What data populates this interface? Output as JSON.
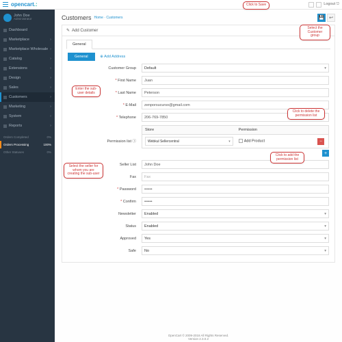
{
  "brand": {
    "name": "opencart"
  },
  "top": {
    "logout": "Logout"
  },
  "user": {
    "name": "John Doe",
    "role": "Administrator"
  },
  "nav": {
    "items": [
      {
        "label": "Dashboard"
      },
      {
        "label": "Marketplace"
      },
      {
        "label": "Marketplace Wholesale"
      },
      {
        "label": "Catalog"
      },
      {
        "label": "Extensions"
      },
      {
        "label": "Design"
      },
      {
        "label": "Sales"
      },
      {
        "label": "Customers"
      },
      {
        "label": "Marketing"
      },
      {
        "label": "System"
      },
      {
        "label": "Reports"
      }
    ],
    "sub": [
      {
        "label": "Orders Completed",
        "val": "0%"
      },
      {
        "label": "Orders Processing",
        "val": "100%"
      },
      {
        "label": "Other Statuses",
        "val": "0%"
      }
    ]
  },
  "page": {
    "title": "Customers",
    "crumb_home": "Home",
    "crumb_cur": "Customers",
    "panel": "Add Customer"
  },
  "tabs": {
    "general": "General"
  },
  "subtabs": {
    "general": "General",
    "add_addr": "Add Address"
  },
  "labels": {
    "group": "Customer Group",
    "fname": "First Name",
    "lname": "Last Name",
    "email": "E-Mail",
    "phone": "Telephone",
    "perm": "Permission list",
    "store": "Store",
    "permcol": "Permission",
    "seller": "Seller List",
    "fax": "Fax",
    "pwd": "Password",
    "confirm": "Confirm",
    "news": "Newsletter",
    "status": "Status",
    "approved": "Approved",
    "safe": "Safe"
  },
  "values": {
    "group": "Default",
    "fname": "Juan",
    "lname": "Peterson",
    "email": "zenporsucurso@gmail.com",
    "phone": "206-769-7850",
    "store": "Webkul Sellercentral",
    "permopt": "Add Product",
    "seller": "John Doe",
    "fax": "Fax",
    "pwd": "••••••",
    "confirm": "••••••",
    "news": "Enabled",
    "status": "Enabled",
    "approved": "Yes",
    "safe": "No"
  },
  "callouts": {
    "save": "Click to Save",
    "group": "Select the Customer group",
    "enter": "Enter the sub-user details",
    "seller": "Select the seller for whom you are creating the sub-user",
    "del": "Click to delete the permission list",
    "add": "Click to add the permission list"
  },
  "footer": {
    "l1": "OpenCart © 2009-2018 All Rights Reserved.",
    "l2": "Version 2.3.0.2"
  }
}
